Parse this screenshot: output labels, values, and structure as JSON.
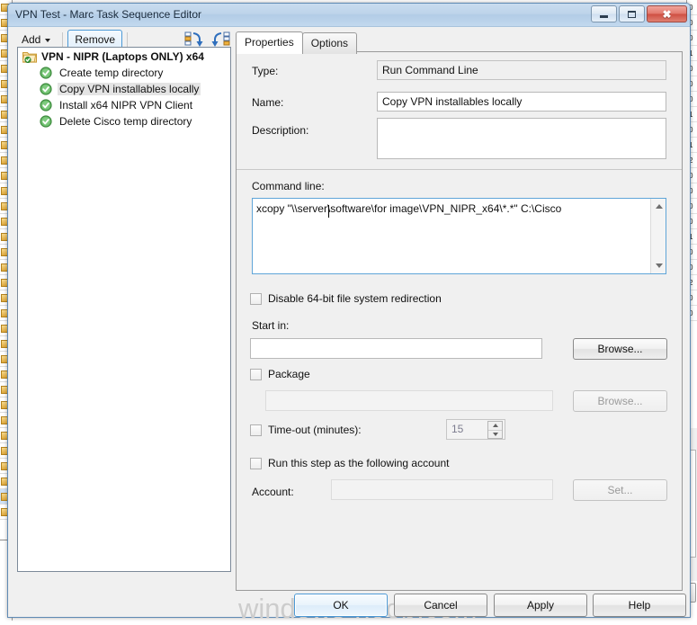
{
  "background": {
    "left_rows": 34,
    "right_rows": [
      "0",
      "0",
      "0",
      "1",
      "0",
      "0",
      "0",
      "1",
      "0",
      "1",
      "2",
      "0",
      "0",
      "0",
      "0",
      "1",
      "0",
      "0",
      "2",
      "0",
      "0"
    ]
  },
  "window": {
    "title": "VPN Test - Marc Task Sequence Editor",
    "controls": {
      "minimize": "minimize-button",
      "maximize": "maximize-button",
      "close_label": "✖"
    }
  },
  "toolbar": {
    "add_label": "Add",
    "remove_label": "Remove",
    "icon1": "reorder-down-icon",
    "icon2": "reorder-up-icon"
  },
  "tabs": [
    {
      "label": "Properties",
      "active": true
    },
    {
      "label": "Options",
      "active": false
    }
  ],
  "tree": {
    "root": {
      "label": "VPN - NIPR (Laptops ONLY) x64",
      "icon": "folder-check-icon"
    },
    "items": [
      {
        "label": "Create temp directory",
        "icon": "step-check-icon",
        "selected": false
      },
      {
        "label": "Copy VPN installables locally",
        "icon": "step-check-icon",
        "selected": true
      },
      {
        "label": "Install x64 NIPR VPN Client",
        "icon": "step-check-icon",
        "selected": false
      },
      {
        "label": "Delete Cisco temp directory",
        "icon": "step-check-icon",
        "selected": false
      }
    ]
  },
  "properties": {
    "type_label": "Type:",
    "type_value": "Run Command Line",
    "name_label": "Name:",
    "name_value": "Copy VPN installables locally",
    "description_label": "Description:",
    "description_value": "",
    "command_line_label": "Command line:",
    "command_line_value": "xcopy \"\\\\server\\software\\for image\\VPN_NIPR_x64\\*.*\" C:\\Cisco",
    "disable_redirection_label": "Disable 64-bit file system redirection",
    "disable_redirection_checked": false,
    "start_in_label": "Start in:",
    "start_in_value": "",
    "start_in_browse_label": "Browse...",
    "package_label": "Package",
    "package_checked": false,
    "package_value": "",
    "package_browse_label": "Browse...",
    "timeout_label": "Time-out (minutes):",
    "timeout_checked": false,
    "timeout_value": "15",
    "run_as_label": "Run this step as the following account",
    "run_as_checked": false,
    "account_label": "Account:",
    "account_value": "",
    "account_set_label": "Set..."
  },
  "footer": {
    "watermark": "windows-noob.com",
    "buttons": [
      {
        "label": "OK",
        "primary": true
      },
      {
        "label": "Cancel",
        "primary": false
      },
      {
        "label": "Apply",
        "primary": false
      },
      {
        "label": "Help",
        "primary": false
      }
    ]
  },
  "colors": {
    "accent": "#4d9ad6",
    "titlebar": "#bdd4ea",
    "face": "#f0f0f0",
    "check_green": "#4ca64c",
    "close_red": "#cf4f42"
  }
}
